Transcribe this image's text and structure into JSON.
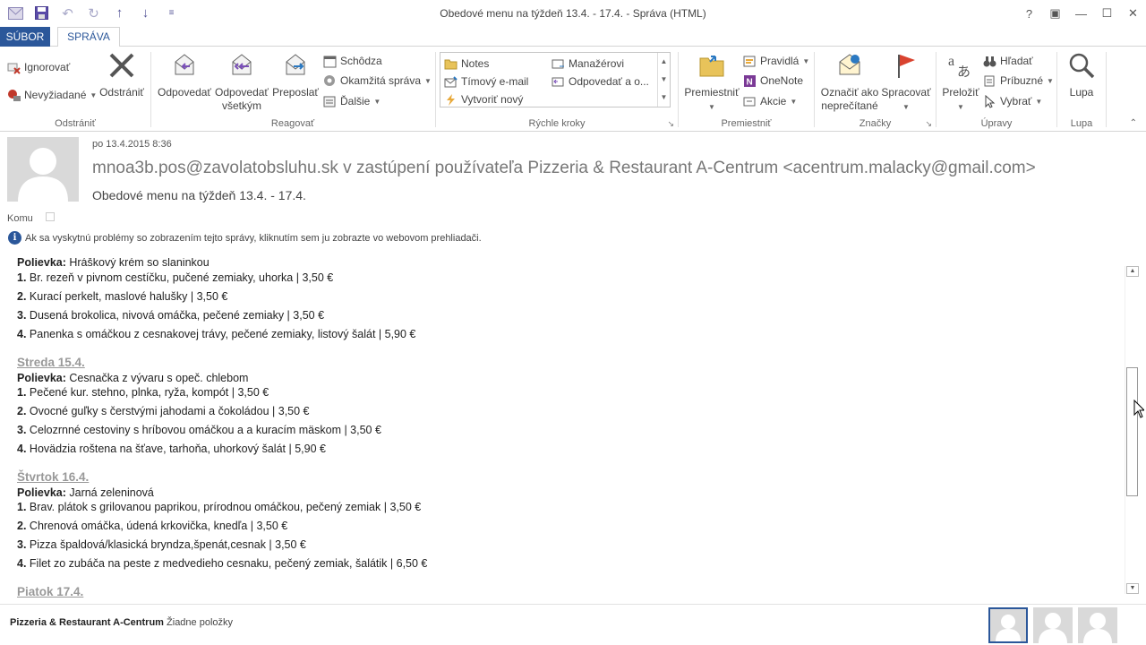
{
  "window": {
    "title": "Obedové menu na týždeň 13.4. - 17.4. - Správa (HTML)",
    "controls": [
      "?",
      "▣",
      "—",
      "☐",
      "✕"
    ]
  },
  "tabs": {
    "file": "SÚBOR",
    "message": "SPRÁVA"
  },
  "ribbon": {
    "delete_group": {
      "label": "Odstrániť",
      "ignore": "Ignorovať",
      "junk": "Nevyžiadané",
      "delete": "Odstrániť"
    },
    "respond_group": {
      "label": "Reagovať",
      "reply": "Odpovedať",
      "reply_all_1": "Odpovedať",
      "reply_all_2": "všetkým",
      "forward": "Preposlať",
      "meeting": "Schôdza",
      "im": "Okamžitá správa",
      "more": "Ďalšie"
    },
    "quicksteps_group": {
      "label": "Rýchle kroky",
      "items": [
        "Notes",
        "Manažérovi",
        "Tímový e-mail",
        "Odpovedať a o...",
        "Vytvoriť nový"
      ]
    },
    "move_group": {
      "label": "Premiestniť",
      "move": "Premiestniť",
      "rules": "Pravidlá",
      "onenote": "OneNote",
      "actions": "Akcie"
    },
    "tags_group": {
      "label": "Značky",
      "mark_unread_1": "Označiť ako",
      "mark_unread_2": "neprečítané",
      "followup": "Spracovať"
    },
    "editing_group": {
      "label": "Úpravy",
      "translate": "Preložiť",
      "find": "Hľadať",
      "related": "Príbuzné",
      "select": "Vybrať"
    },
    "zoom_group": {
      "label": "Lupa",
      "zoom": "Lupa"
    }
  },
  "header": {
    "date": "po 13.4.2015 8:36",
    "from": "mnoa3b.pos@zavolatobsluhu.sk v zastúpení používateľa Pizzeria & Restaurant A-Centrum <acentrum.malacky@gmail.com>",
    "subject": "Obedové menu na týždeň 13.4. - 17.4.",
    "to_label": "Komu",
    "info": "Ak sa vyskytnú problémy so zobrazením tejto správy, kliknutím sem ju zobrazte vo webovom prehliadači."
  },
  "body": {
    "partial_top": {
      "label": "Polievka:",
      "text": " Hráškový krém so slaninkou"
    },
    "tuesday_items": [
      {
        "num": "1.",
        "text": " Br. rezeň v pivnom cestíčku, pučené zemiaky, uhorka | 3,50 €"
      },
      {
        "num": "2.",
        "text": " Kurací perkelt, maslové halušky | 3,50 €"
      },
      {
        "num": "3.",
        "text": " Dusená brokolica, nivová omáčka, pečené zemiaky | 3,50 €"
      },
      {
        "num": "4.",
        "text": " Panenka s omáčkou z cesnakovej trávy, pečené zemiaky, listový šalát | 5,90 €"
      }
    ],
    "wednesday": {
      "title": "Streda 15.4.",
      "soup_label": "Polievka:",
      "soup": " Cesnačka z vývaru s opeč. chlebom",
      "items": [
        {
          "num": "1.",
          "text": " Pečené kur. stehno, plnka, ryža, kompót | 3,50 €"
        },
        {
          "num": "2.",
          "text": " Ovocné guľky s čerstvými jahodami a čokoládou | 3,50 €"
        },
        {
          "num": "3.",
          "text": " Celozrnné cestoviny s hríbovou omáčkou a a kuracím mäskom | 3,50 €"
        },
        {
          "num": "4.",
          "text": " Hovädzia roštena na šťave, tarhoňa, uhorkový šalát | 5,90 €"
        }
      ]
    },
    "thursday": {
      "title": "Štvrtok 16.4.",
      "soup_label": "Polievka:",
      "soup": " Jarná zeleninová",
      "items": [
        {
          "num": "1.",
          "text": " Brav. plátok s grilovanou paprikou, prírodnou omáčkou, pečený zemiak | 3,50 €"
        },
        {
          "num": "2.",
          "text": " Chrenová omáčka, údená krkovička, knedľa | 3,50 €"
        },
        {
          "num": "3.",
          "text": " Pizza špaldová/klasická bryndza,špenát,cesnak | 3,50 €"
        },
        {
          "num": "4.",
          "text": " Filet zo zubáča na peste z medvedieho cesnaku, pečený zemiak, šalátik | 6,50 €"
        }
      ]
    },
    "friday": {
      "title": "Piatok 17.4."
    }
  },
  "status": {
    "sender": "Pizzeria & Restaurant A-Centrum",
    "items": "Žiadne položky"
  },
  "colors": {
    "accent": "#2b579a"
  }
}
